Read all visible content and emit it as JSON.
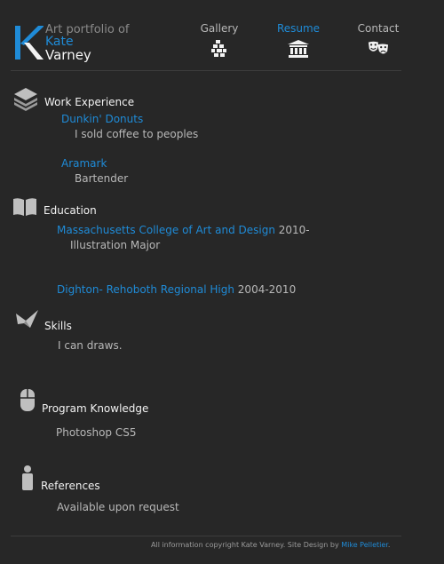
{
  "logo": {
    "line1": "Art portfolio of",
    "line2": "Kate",
    "line3": "Varney",
    "monogram_color": "#1f8bd7"
  },
  "nav": {
    "items": [
      {
        "label": "Gallery",
        "icon": "gallery-icon",
        "active": false
      },
      {
        "label": "Resume",
        "icon": "building-icon",
        "active": true
      },
      {
        "label": "Contact",
        "icon": "theater-masks-icon",
        "active": false
      }
    ]
  },
  "sections": {
    "work": {
      "heading": "Work Experience",
      "icon": "stack-icon",
      "entries": [
        {
          "title": "Dunkin' Donuts",
          "detail": "I sold coffee to peoples"
        },
        {
          "title": "Aramark",
          "detail": "Bartender"
        }
      ]
    },
    "education": {
      "heading": "Education",
      "icon": "book-icon",
      "entries": [
        {
          "title": "Massachusetts College of Art and Design",
          "dates": "2010-",
          "detail": "Illustration Major"
        },
        {
          "title": "Dighton- Rehoboth Regional High",
          "dates": "2004-2010"
        }
      ]
    },
    "skills": {
      "heading": "Skills",
      "icon": "paper-crane-icon",
      "detail": "I can draws."
    },
    "programs": {
      "heading": "Program Knowledge",
      "icon": "mouse-icon",
      "detail": "Photoshop CS5"
    },
    "references": {
      "heading": "References",
      "icon": "person-icon",
      "detail": "Available upon request"
    }
  },
  "footer": {
    "copyright": "All information copyright Kate Varney. Site Design by",
    "designer": "Mike Pelletier",
    "suffix": "."
  },
  "colors": {
    "background": "#272727",
    "accent": "#1f8bd7",
    "muted_text": "#b8b8b8"
  }
}
